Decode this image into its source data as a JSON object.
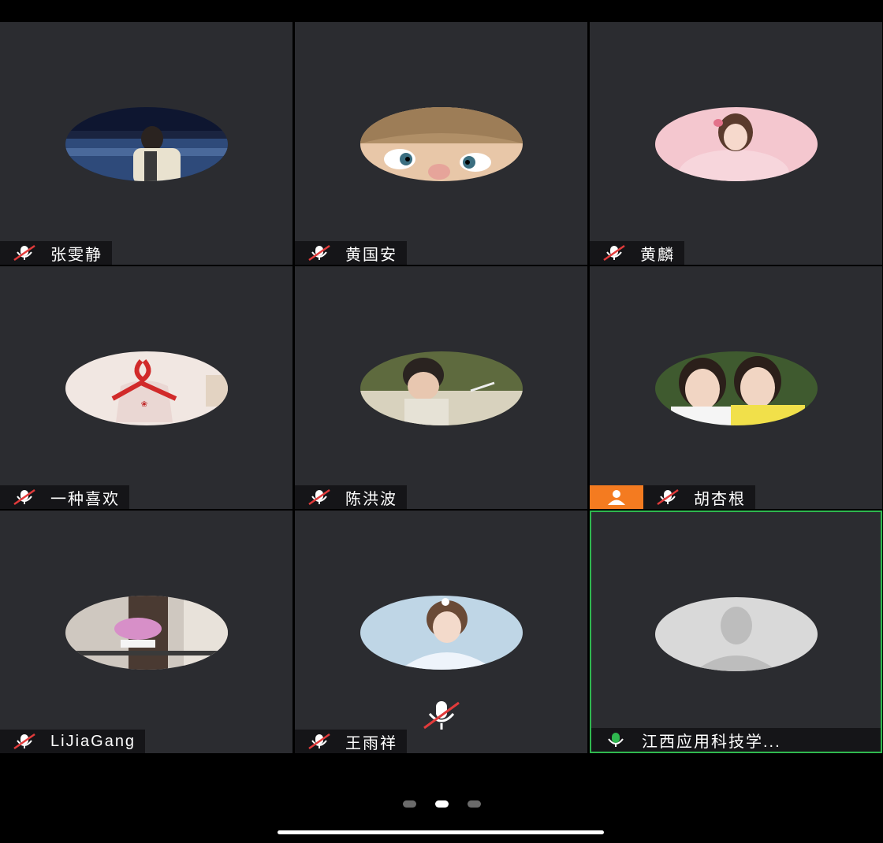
{
  "participants": [
    {
      "name": "张雯静",
      "mic": "muted"
    },
    {
      "name": "黄国安",
      "mic": "muted"
    },
    {
      "name": "黄麟",
      "mic": "muted"
    },
    {
      "name": "一种喜欢",
      "mic": "muted"
    },
    {
      "name": "陈洪波",
      "mic": "muted"
    },
    {
      "name": "胡杏根",
      "mic": "muted",
      "host": true
    },
    {
      "name": "LiJiaGang",
      "mic": "muted"
    },
    {
      "name": "王雨祥",
      "mic": "muted"
    },
    {
      "name": "江西应用科技学...",
      "mic": "on",
      "active_speaker": true
    }
  ],
  "pagination": {
    "pages": 3,
    "current": 2
  },
  "colors": {
    "tile_bg": "#2b2c30",
    "active_border": "#2fb84f",
    "host_badge": "#f47b20",
    "muted_slash": "#e23b3b"
  },
  "icons": {
    "muted": "mic-muted-icon",
    "unmuted": "mic-icon",
    "host": "host-person-icon",
    "default_avatar": "default-avatar-icon"
  }
}
